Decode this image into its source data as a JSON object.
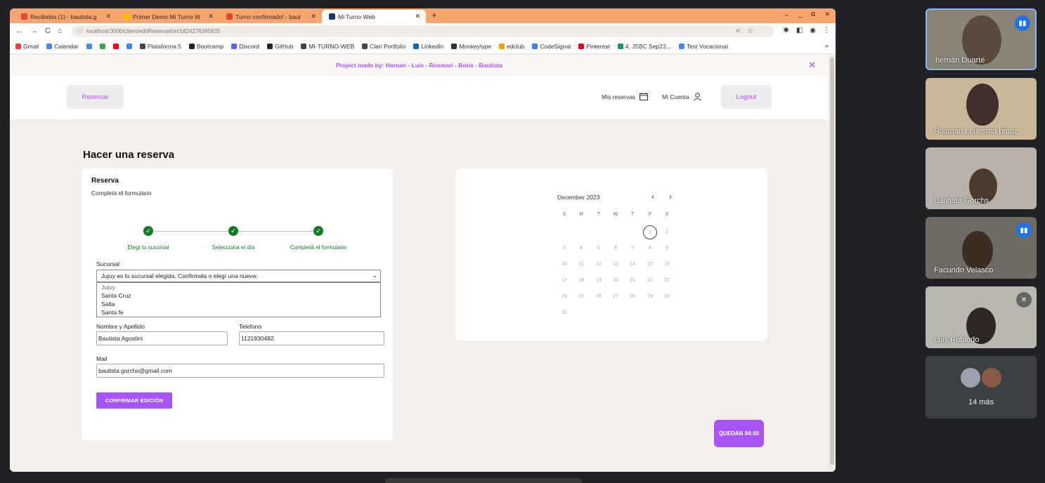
{
  "browser": {
    "tabs": [
      {
        "label": "Recibidos (1) - bautista.g",
        "icon_color": "#ea4335",
        "active": false
      },
      {
        "label": "Primer Demo Mi Turno W",
        "icon_color": "#fbbc04",
        "active": false
      },
      {
        "label": "Turno confirmado! - baut",
        "icon_color": "#ea4335",
        "active": false
      },
      {
        "label": "Mi Turno Web",
        "icon_color": "#1e3a5f",
        "active": true
      }
    ],
    "new_tab": "+",
    "window_controls": [
      "⌄",
      "_",
      "⧉",
      "✕"
    ],
    "nav": {
      "back": "←",
      "forward": "→",
      "reload": "C",
      "home": "⌂"
    },
    "url": "localhost:3000/client/editReservation/1824278395835",
    "bookmarks": [
      {
        "label": "Gmail",
        "color": "#ea4335"
      },
      {
        "label": "Calendar",
        "color": "#4285f4"
      },
      {
        "label": "",
        "color": "#4285f4"
      },
      {
        "label": "",
        "color": "#34a853"
      },
      {
        "label": "",
        "color": "#ff0000"
      },
      {
        "label": "",
        "color": "#4285f4"
      },
      {
        "label": "Plataforma 5",
        "color": "#444444"
      },
      {
        "label": "Bootcamp",
        "color": "#222222"
      },
      {
        "label": "Discord",
        "color": "#5865f2"
      },
      {
        "label": "GitHub",
        "color": "#222222"
      },
      {
        "label": "MI-TURNO-WEB",
        "color": "#444444"
      },
      {
        "label": "Clari Portfolio",
        "color": "#444444"
      },
      {
        "label": "LinkedIn",
        "color": "#0a66c2"
      },
      {
        "label": "Monkeytype",
        "color": "#333333"
      },
      {
        "label": "edclub",
        "color": "#f59e0b"
      },
      {
        "label": "CodeSignal",
        "color": "#3b82f6"
      },
      {
        "label": "Pinterest",
        "color": "#e60023"
      },
      {
        "label": "4. JSBC Sep23...",
        "color": "#0f9d58"
      },
      {
        "label": "Test Vocacional",
        "color": "#4285f4"
      }
    ],
    "bookmarks_more": "»"
  },
  "app": {
    "banner": "Project made by: Hernan - Luis - Rosmari - Boris - Bautista",
    "banner_close": "✕",
    "header": {
      "reservar": "Reservar",
      "mis_reservas": "Mis reservas",
      "mi_cuenta": "Mi Cuenta",
      "logout": "Logout"
    },
    "page_title": "Hacer una reserva",
    "form": {
      "title": "Reserva",
      "subtitle": "Completá el formulario",
      "steps": [
        "Elegí tu sucursal",
        "Selecciona el día",
        "Completá el formulario"
      ],
      "step_check": "✓",
      "sucursal_label": "Sucursal",
      "sucursal_value": "Jujuy es tu sucursal elegida. Confirmala o elegí una nueva:",
      "sucursal_options": [
        "Jujuy",
        "Santa Cruz",
        "Salta",
        "Santa fe"
      ],
      "nombre_label": "Nombre y Apellido",
      "nombre_value": "Bautista Agostini",
      "telefono_label": "Telefono",
      "telefono_value": "1121930482",
      "mail_label": "Mail",
      "mail_value": "bautista.gorchs@gmail.com",
      "confirm_button": "CONFIRMAR EDICIÓN"
    },
    "calendar": {
      "month": "December 2023",
      "prev": "‹",
      "next": "›",
      "weekdays": [
        "S",
        "M",
        "T",
        "W",
        "T",
        "F",
        "S"
      ],
      "days": [
        [
          "",
          "",
          "",
          "",
          "",
          "1",
          "2"
        ],
        [
          "3",
          "4",
          "5",
          "6",
          "7",
          "8",
          "9"
        ],
        [
          "10",
          "11",
          "12",
          "13",
          "14",
          "15",
          "16"
        ],
        [
          "17",
          "18",
          "19",
          "20",
          "21",
          "22",
          "23"
        ],
        [
          "24",
          "25",
          "26",
          "27",
          "28",
          "29",
          "30"
        ],
        [
          "31",
          "",
          "",
          "",
          "",
          "",
          ""
        ]
      ],
      "selected_day": "1"
    },
    "timer": "QUEDAN 04:40"
  },
  "meet": {
    "participants": [
      {
        "name": "hernán Duarte",
        "badge": "speaking",
        "bg": "#8a8478"
      },
      {
        "name": "Rosmari Ledesma britez",
        "badge": "",
        "bg": "#c9b79a"
      },
      {
        "name": "Bautista Gorchs",
        "badge": "",
        "bg": "#b8b2a8"
      },
      {
        "name": "Facundo Velasco",
        "badge": "speaking",
        "bg": "#6f6a63"
      },
      {
        "name": "Luis Robledo",
        "badge": "muted",
        "bg": "#b9b7ae"
      }
    ],
    "more_label": "14 más"
  }
}
